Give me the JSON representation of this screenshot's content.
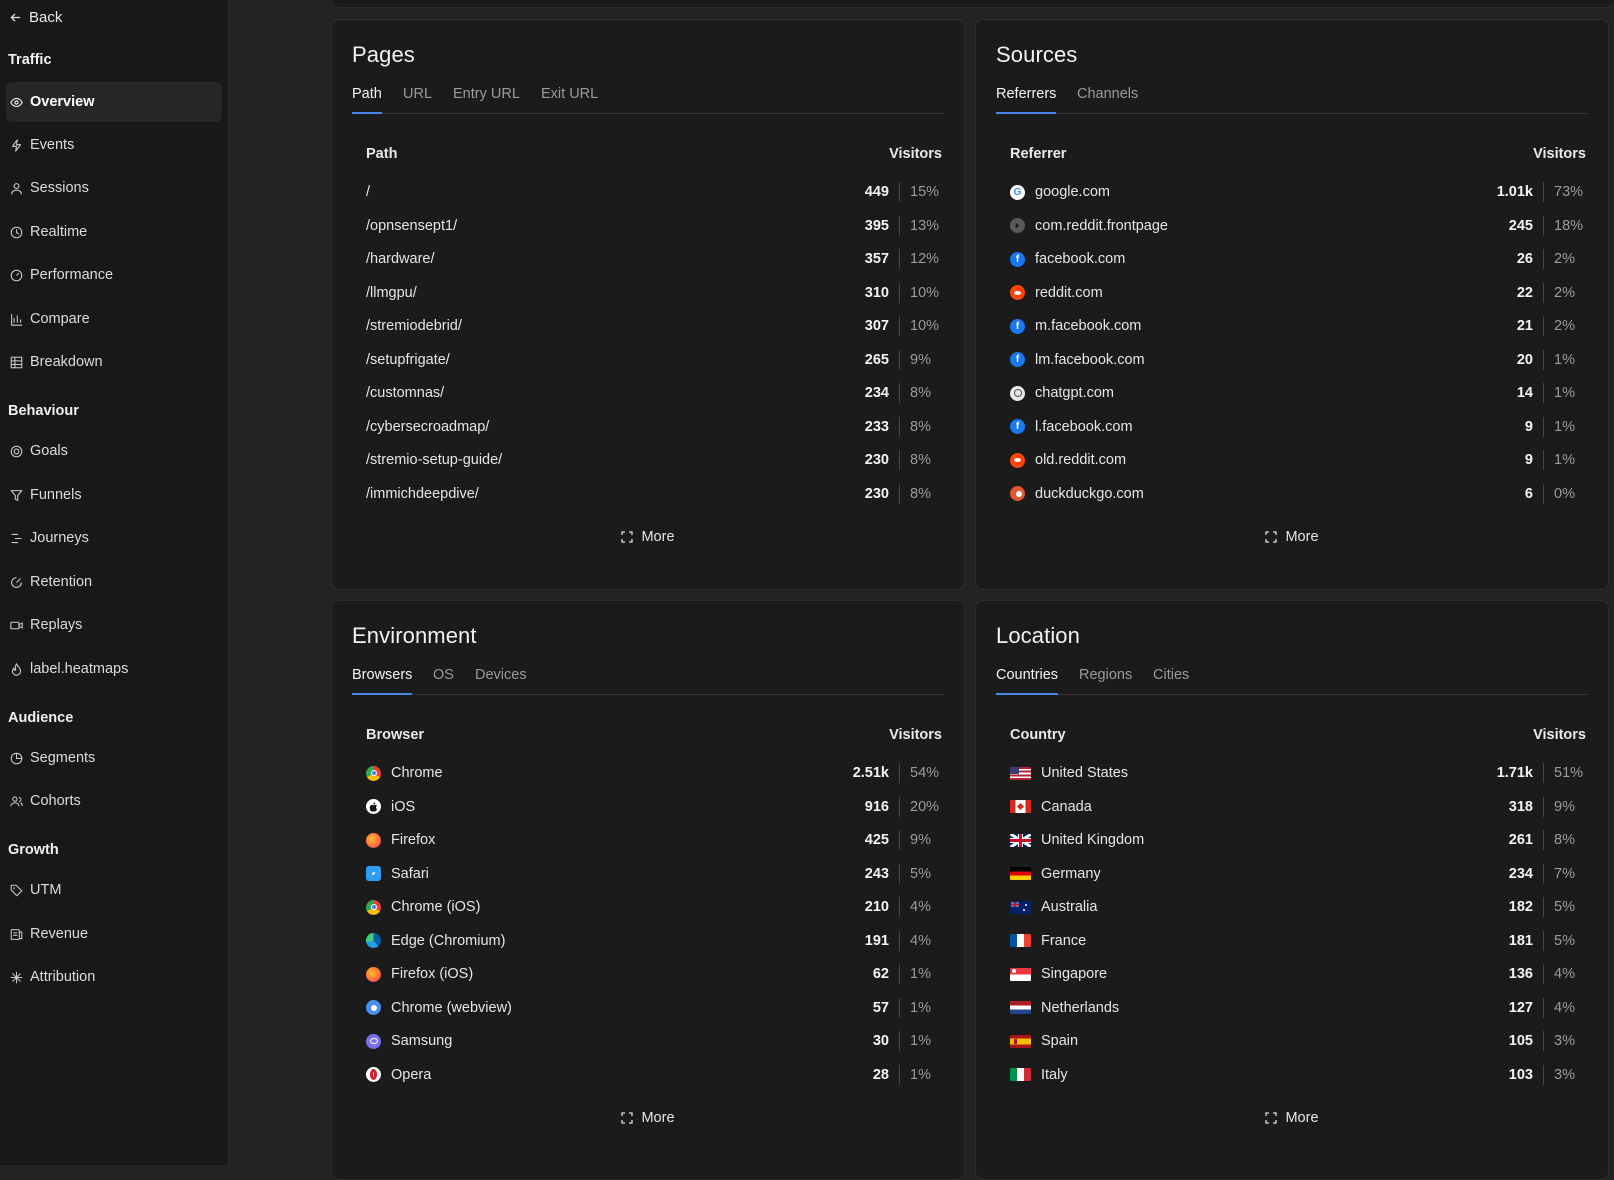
{
  "sidebar": {
    "back": "Back",
    "sections": [
      {
        "title": "Traffic",
        "items": [
          {
            "label": "Overview",
            "icon": "eye-icon",
            "active": true
          },
          {
            "label": "Events",
            "icon": "bolt-icon"
          },
          {
            "label": "Sessions",
            "icon": "user-icon"
          },
          {
            "label": "Realtime",
            "icon": "clock-icon"
          },
          {
            "label": "Performance",
            "icon": "gauge-icon"
          },
          {
            "label": "Compare",
            "icon": "bar-chart-icon"
          },
          {
            "label": "Breakdown",
            "icon": "grid-icon"
          }
        ]
      },
      {
        "title": "Behaviour",
        "items": [
          {
            "label": "Goals",
            "icon": "target-icon"
          },
          {
            "label": "Funnels",
            "icon": "funnel-icon"
          },
          {
            "label": "Journeys",
            "icon": "route-icon"
          },
          {
            "label": "Retention",
            "icon": "retention-icon"
          },
          {
            "label": "Replays",
            "icon": "video-icon"
          },
          {
            "label": "label.heatmaps",
            "icon": "flame-icon"
          }
        ]
      },
      {
        "title": "Audience",
        "items": [
          {
            "label": "Segments",
            "icon": "pie-icon"
          },
          {
            "label": "Cohorts",
            "icon": "users-icon"
          }
        ]
      },
      {
        "title": "Growth",
        "items": [
          {
            "label": "UTM",
            "icon": "tag-icon"
          },
          {
            "label": "Revenue",
            "icon": "coins-icon"
          },
          {
            "label": "Attribution",
            "icon": "sparkle-icon"
          }
        ]
      }
    ]
  },
  "cards": {
    "pages": {
      "title": "Pages",
      "tabs": [
        "Path",
        "URL",
        "Entry URL",
        "Exit URL"
      ],
      "col_left": "Path",
      "col_right": "Visitors",
      "rows": [
        {
          "label": "/",
          "value": "449",
          "pct": "15%"
        },
        {
          "label": "/opnsensept1/",
          "value": "395",
          "pct": "13%"
        },
        {
          "label": "/hardware/",
          "value": "357",
          "pct": "12%"
        },
        {
          "label": "/llmgpu/",
          "value": "310",
          "pct": "10%"
        },
        {
          "label": "/stremiodebrid/",
          "value": "307",
          "pct": "10%"
        },
        {
          "label": "/setupfrigate/",
          "value": "265",
          "pct": "9%"
        },
        {
          "label": "/customnas/",
          "value": "234",
          "pct": "8%"
        },
        {
          "label": "/cybersecroadmap/",
          "value": "233",
          "pct": "8%"
        },
        {
          "label": "/stremio-setup-guide/",
          "value": "230",
          "pct": "8%"
        },
        {
          "label": "/immichdeepdive/",
          "value": "230",
          "pct": "8%"
        }
      ],
      "more": "More"
    },
    "sources": {
      "title": "Sources",
      "tabs": [
        "Referrers",
        "Channels"
      ],
      "col_left": "Referrer",
      "col_right": "Visitors",
      "rows": [
        {
          "label": "google.com",
          "value": "1.01k",
          "pct": "73%",
          "icon": "google-icon"
        },
        {
          "label": "com.reddit.frontpage",
          "value": "245",
          "pct": "18%",
          "icon": "globe-icon"
        },
        {
          "label": "facebook.com",
          "value": "26",
          "pct": "2%",
          "icon": "facebook-icon"
        },
        {
          "label": "reddit.com",
          "value": "22",
          "pct": "2%",
          "icon": "reddit-icon"
        },
        {
          "label": "m.facebook.com",
          "value": "21",
          "pct": "2%",
          "icon": "facebook-icon"
        },
        {
          "label": "lm.facebook.com",
          "value": "20",
          "pct": "1%",
          "icon": "facebook-icon"
        },
        {
          "label": "chatgpt.com",
          "value": "14",
          "pct": "1%",
          "icon": "chatgpt-icon"
        },
        {
          "label": "l.facebook.com",
          "value": "9",
          "pct": "1%",
          "icon": "facebook-icon"
        },
        {
          "label": "old.reddit.com",
          "value": "9",
          "pct": "1%",
          "icon": "reddit-icon"
        },
        {
          "label": "duckduckgo.com",
          "value": "6",
          "pct": "0%",
          "icon": "duckduckgo-icon"
        }
      ],
      "more": "More"
    },
    "environment": {
      "title": "Environment",
      "tabs": [
        "Browsers",
        "OS",
        "Devices"
      ],
      "col_left": "Browser",
      "col_right": "Visitors",
      "rows": [
        {
          "label": "Chrome",
          "value": "2.51k",
          "pct": "54%",
          "icon": "chrome-icon"
        },
        {
          "label": "iOS",
          "value": "916",
          "pct": "20%",
          "icon": "apple-icon"
        },
        {
          "label": "Firefox",
          "value": "425",
          "pct": "9%",
          "icon": "firefox-icon"
        },
        {
          "label": "Safari",
          "value": "243",
          "pct": "5%",
          "icon": "safari-icon"
        },
        {
          "label": "Chrome (iOS)",
          "value": "210",
          "pct": "4%",
          "icon": "chrome-icon"
        },
        {
          "label": "Edge (Chromium)",
          "value": "191",
          "pct": "4%",
          "icon": "edge-icon"
        },
        {
          "label": "Firefox (iOS)",
          "value": "62",
          "pct": "1%",
          "icon": "firefox-icon"
        },
        {
          "label": "Chrome (webview)",
          "value": "57",
          "pct": "1%",
          "icon": "chrome-webview-icon"
        },
        {
          "label": "Samsung",
          "value": "30",
          "pct": "1%",
          "icon": "samsung-icon"
        },
        {
          "label": "Opera",
          "value": "28",
          "pct": "1%",
          "icon": "opera-icon"
        }
      ],
      "more": "More"
    },
    "location": {
      "title": "Location",
      "tabs": [
        "Countries",
        "Regions",
        "Cities"
      ],
      "col_left": "Country",
      "col_right": "Visitors",
      "rows": [
        {
          "label": "United States",
          "value": "1.71k",
          "pct": "51%",
          "icon": "flag-us-icon"
        },
        {
          "label": "Canada",
          "value": "318",
          "pct": "9%",
          "icon": "flag-ca-icon"
        },
        {
          "label": "United Kingdom",
          "value": "261",
          "pct": "8%",
          "icon": "flag-gb-icon"
        },
        {
          "label": "Germany",
          "value": "234",
          "pct": "7%",
          "icon": "flag-de-icon"
        },
        {
          "label": "Australia",
          "value": "182",
          "pct": "5%",
          "icon": "flag-au-icon"
        },
        {
          "label": "France",
          "value": "181",
          "pct": "5%",
          "icon": "flag-fr-icon"
        },
        {
          "label": "Singapore",
          "value": "136",
          "pct": "4%",
          "icon": "flag-sg-icon"
        },
        {
          "label": "Netherlands",
          "value": "127",
          "pct": "4%",
          "icon": "flag-nl-icon"
        },
        {
          "label": "Spain",
          "value": "105",
          "pct": "3%",
          "icon": "flag-es-icon"
        },
        {
          "label": "Italy",
          "value": "103",
          "pct": "3%",
          "icon": "flag-it-icon"
        }
      ],
      "more": "More"
    }
  },
  "colors": {
    "accent": "#4a86e8",
    "background": "#232323",
    "card": "#1b1b1b",
    "sidebar": "#181818"
  }
}
